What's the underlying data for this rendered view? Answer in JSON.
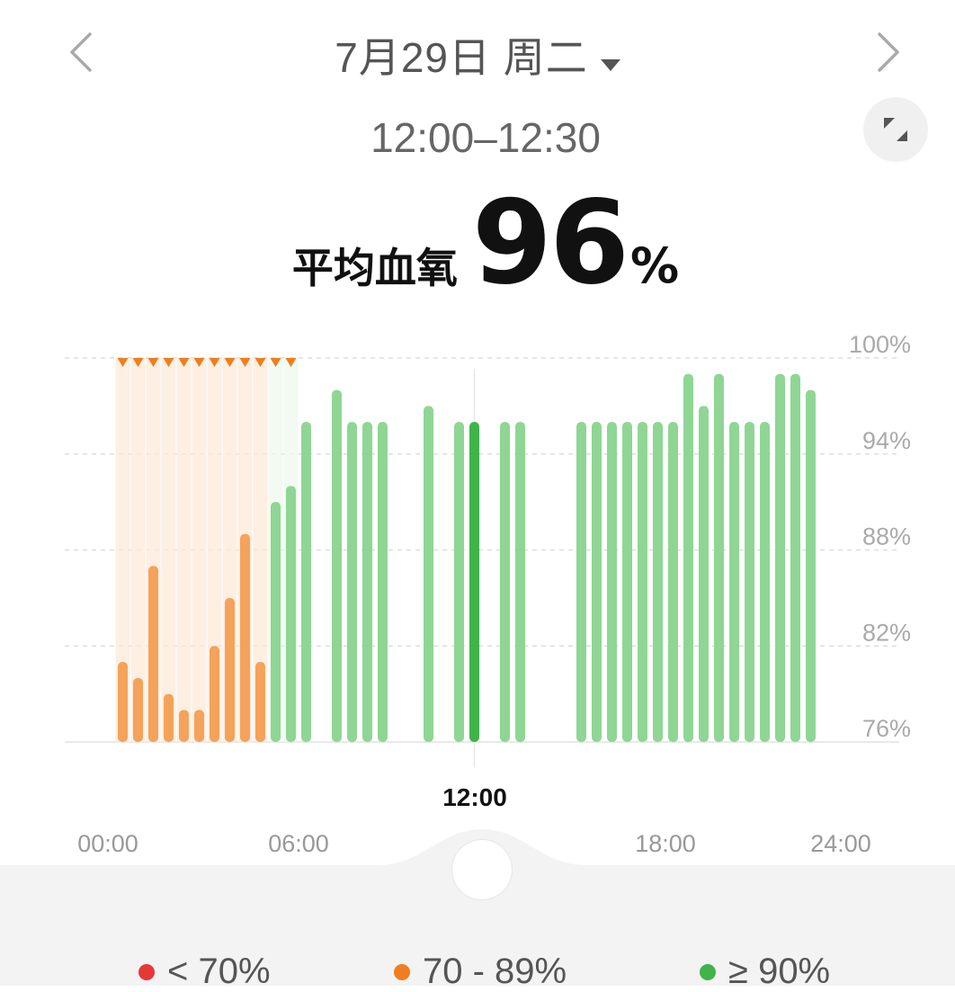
{
  "header": {
    "date_label": "7月29日 周二",
    "time_range": "12:00–12:30",
    "avg_label": "平均血氧",
    "avg_value": "96",
    "avg_unit": "%"
  },
  "colors": {
    "orange": "#f5a25b",
    "orange_light": "#fde9d9",
    "green": "#8fd694",
    "green_selected": "#3fb44a",
    "red": "#e53935",
    "marker": "#f07d1e"
  },
  "chart_data": {
    "type": "bar",
    "xlabel": "",
    "ylabel": "",
    "ylim": [
      76,
      100
    ],
    "y_ticks": [
      "100%",
      "94%",
      "88%",
      "82%",
      "76%"
    ],
    "y_tick_values": [
      100,
      94,
      88,
      82,
      76
    ],
    "x_ticks": [
      "00:00",
      "06:00",
      "18:00",
      "24:00"
    ],
    "x_tick_values": [
      0,
      6,
      18,
      24
    ],
    "selected_time_label": "12:00",
    "selected_time": 12.25,
    "grid": true,
    "series": [
      {
        "bars": [
          {
            "t": 0.25,
            "v": 81
          },
          {
            "t": 0.75,
            "v": 80
          },
          {
            "t": 1.25,
            "v": 87
          },
          {
            "t": 1.75,
            "v": 79
          },
          {
            "t": 2.25,
            "v": 78
          },
          {
            "t": 2.75,
            "v": 78
          },
          {
            "t": 3.25,
            "v": 82
          },
          {
            "t": 3.75,
            "v": 85
          },
          {
            "t": 4.25,
            "v": 89
          },
          {
            "t": 4.75,
            "v": 81
          },
          {
            "t": 5.25,
            "v": 91
          },
          {
            "t": 5.75,
            "v": 92
          },
          {
            "t": 6.25,
            "v": 96
          },
          {
            "t": 7.25,
            "v": 98
          },
          {
            "t": 7.75,
            "v": 96
          },
          {
            "t": 8.25,
            "v": 96
          },
          {
            "t": 8.75,
            "v": 96
          },
          {
            "t": 10.25,
            "v": 97
          },
          {
            "t": 11.25,
            "v": 96
          },
          {
            "t": 12.75,
            "v": 96
          },
          {
            "t": 13.25,
            "v": 96
          },
          {
            "t": 15.25,
            "v": 96
          },
          {
            "t": 15.75,
            "v": 96
          },
          {
            "t": 16.25,
            "v": 96
          },
          {
            "t": 16.75,
            "v": 96
          },
          {
            "t": 17.25,
            "v": 96
          },
          {
            "t": 17.75,
            "v": 96
          },
          {
            "t": 18.25,
            "v": 96
          },
          {
            "t": 18.75,
            "v": 99
          },
          {
            "t": 19.25,
            "v": 97
          },
          {
            "t": 19.75,
            "v": 99
          },
          {
            "t": 20.25,
            "v": 96
          },
          {
            "t": 20.75,
            "v": 96
          },
          {
            "t": 21.25,
            "v": 96
          },
          {
            "t": 21.75,
            "v": 99
          },
          {
            "t": 22.25,
            "v": 99
          },
          {
            "t": 22.75,
            "v": 98
          }
        ],
        "selected_bar": {
          "t": 11.75,
          "v": 96
        }
      }
    ],
    "alert_markers": [
      0.25,
      0.75,
      1.25,
      1.75,
      2.25,
      2.75,
      3.25,
      3.75,
      4.25,
      4.75,
      5.25,
      5.75
    ]
  },
  "legend": [
    {
      "label": "< 70%",
      "color": "#e53935"
    },
    {
      "label": "70 - 89%",
      "color": "#f07d1e"
    },
    {
      "label": "≥ 90%",
      "color": "#3fb44a"
    }
  ]
}
